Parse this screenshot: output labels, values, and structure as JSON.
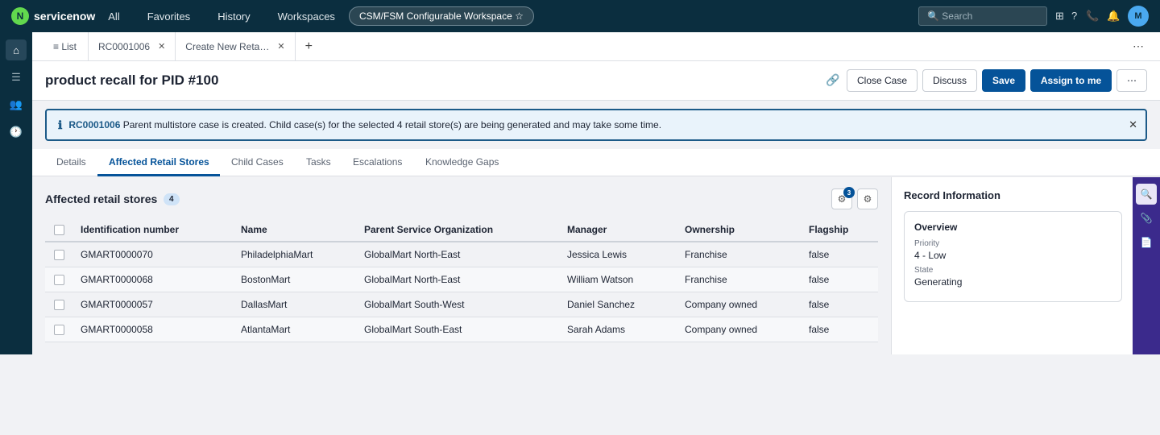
{
  "topbar": {
    "logo_letter": "N",
    "brand": "servicenow",
    "nav": [
      "All",
      "Favorites",
      "History",
      "Workspaces"
    ],
    "workspace": "CSM/FSM Configurable Workspace ☆",
    "search_placeholder": "🔍 Search",
    "avatar": "M"
  },
  "workspace_tabs": {
    "list": "≡ List",
    "tabs": [
      {
        "label": "RC0001006"
      },
      {
        "label": "Create New Reta…"
      }
    ],
    "add": "+",
    "more": "⋯"
  },
  "record": {
    "title": "product recall for PID #100",
    "buttons": {
      "close_case": "Close Case",
      "discuss": "Discuss",
      "save": "Save",
      "assign": "Assign to me",
      "more": "⋯"
    }
  },
  "banner": {
    "case_number": "RC0001006",
    "message": " Parent multistore case is created. Child case(s) for the selected 4 retail store(s) are being generated and may take some time."
  },
  "record_tabs": [
    "Details",
    "Affected Retail Stores",
    "Child Cases",
    "Tasks",
    "Escalations",
    "Knowledge Gaps"
  ],
  "section": {
    "title": "Affected retail stores",
    "count": "4",
    "filter_badge": "3"
  },
  "table": {
    "columns": [
      "Identification number",
      "Name",
      "Parent Service Organization",
      "Manager",
      "Ownership",
      "Flagship"
    ],
    "rows": [
      {
        "id": "GMART0000070",
        "name": "PhiladelphiaMart",
        "org": "GlobalMart North-East",
        "manager": "Jessica Lewis",
        "ownership": "Franchise",
        "flagship": "false"
      },
      {
        "id": "GMART0000068",
        "name": "BostonMart",
        "org": "GlobalMart North-East",
        "manager": "William Watson",
        "ownership": "Franchise",
        "flagship": "false"
      },
      {
        "id": "GMART0000057",
        "name": "DallasMart",
        "org": "GlobalMart South-West",
        "manager": "Daniel Sanchez",
        "ownership": "Company owned",
        "flagship": "false"
      },
      {
        "id": "GMART0000058",
        "name": "AtlantaMart",
        "org": "GlobalMart South-East",
        "manager": "Sarah Adams",
        "ownership": "Company owned",
        "flagship": "false"
      }
    ]
  },
  "record_info": {
    "title": "Record Information",
    "overview_title": "Overview",
    "priority_label": "Priority",
    "priority_value": "4 - Low",
    "state_label": "State",
    "state_value": "Generating"
  },
  "colors": {
    "topbar": "#0b2e3f",
    "primary": "#055399",
    "rail": "#3b2a8c",
    "link": "#1c5a88"
  },
  "icons": [
    "home-icon",
    "list-icon",
    "users-icon",
    "clock-icon",
    "grid-icon",
    "help-icon",
    "phone-icon",
    "bell-icon",
    "link-icon",
    "info-icon",
    "close-icon",
    "filter-icon",
    "settings-icon",
    "search-icon",
    "paperclip-icon",
    "document-icon"
  ]
}
